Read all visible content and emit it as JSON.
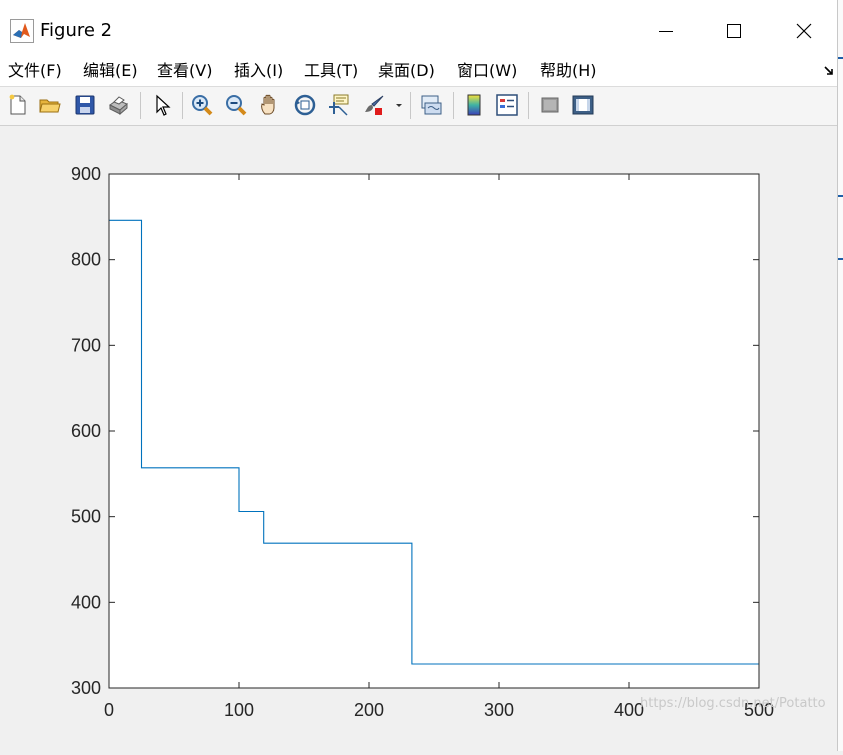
{
  "window": {
    "title": "Figure 2"
  },
  "menu": {
    "items": [
      {
        "label": "文件(F)"
      },
      {
        "label": "编辑(E)"
      },
      {
        "label": "查看(V)"
      },
      {
        "label": "插入(I)"
      },
      {
        "label": "工具(T)"
      },
      {
        "label": "桌面(D)"
      },
      {
        "label": "窗口(W)"
      },
      {
        "label": "帮助(H)"
      }
    ]
  },
  "toolbar": {
    "buttons": [
      {
        "icon": "new-figure-icon"
      },
      {
        "icon": "open-folder-icon"
      },
      {
        "icon": "save-icon"
      },
      {
        "icon": "print-icon"
      },
      {
        "icon": "pointer-icon"
      },
      {
        "icon": "zoom-in-icon"
      },
      {
        "icon": "zoom-out-icon"
      },
      {
        "icon": "pan-hand-icon"
      },
      {
        "icon": "rotate-3d-icon"
      },
      {
        "icon": "data-cursor-icon"
      },
      {
        "icon": "brush-icon"
      },
      {
        "icon": "link-plot-icon"
      },
      {
        "icon": "colorbar-icon"
      },
      {
        "icon": "legend-icon"
      },
      {
        "icon": "hide-plot-tools-icon"
      },
      {
        "icon": "show-plot-tools-icon"
      }
    ]
  },
  "watermark": "https://blog.csdn.net/Potatto",
  "chart_data": {
    "type": "line",
    "title": "",
    "xlabel": "",
    "ylabel": "",
    "xlim": [
      0,
      500
    ],
    "ylim": [
      300,
      900
    ],
    "xticks": [
      0,
      100,
      200,
      300,
      400,
      500
    ],
    "yticks": [
      300,
      400,
      500,
      600,
      700,
      800,
      900
    ],
    "grid": false,
    "color": "#0072bd",
    "series": [
      {
        "x": [
          0,
          25,
          25,
          100,
          100,
          119,
          119,
          233,
          233,
          500
        ],
        "y": [
          846,
          846,
          557,
          557,
          506,
          506,
          469,
          469,
          328,
          328
        ]
      }
    ]
  }
}
